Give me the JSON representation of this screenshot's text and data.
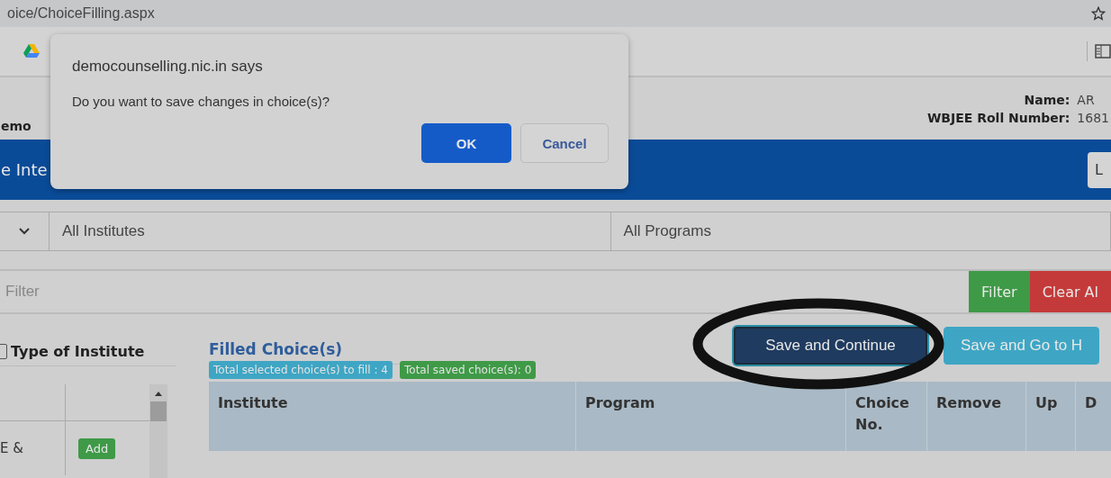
{
  "browser": {
    "url": "oice/ChoiceFilling.aspx"
  },
  "header": {
    "site_title": "emo",
    "name_label": "Name:",
    "name_value": "AR",
    "roll_label": "WBJEE Roll Number:",
    "roll_value": "1681"
  },
  "nav": {
    "item": "e Inte",
    "button": "L"
  },
  "filters": {
    "institutes": "All Institutes",
    "programs": "All Programs",
    "search_placeholder": "Filter",
    "filter_button": "Filter",
    "clear_button": "Clear Al"
  },
  "left_panel": {
    "title": "Type of Institute",
    "checked": false,
    "rows": [
      {
        "name": "E &",
        "action": "Add"
      }
    ]
  },
  "filled": {
    "title": "Filled Choice(s)",
    "badges": [
      {
        "text": "Total selected choice(s) to fill : 4",
        "color": "#3ea6c4"
      },
      {
        "text": "Total saved choice(s): 0",
        "color": "#3f9a47"
      }
    ],
    "buttons": [
      {
        "label": "Save and Continue",
        "kind": "primary"
      },
      {
        "label": "Save and Go to H",
        "kind": "info"
      }
    ],
    "columns": [
      "Institute",
      "Program",
      "Choice No.",
      "Remove",
      "Up",
      "D"
    ]
  },
  "dialog": {
    "title": "democounselling.nic.in says",
    "message": "Do you want to save changes in choice(s)?",
    "buttons": [
      {
        "label": "OK",
        "kind": "primary"
      },
      {
        "label": "Cancel",
        "kind": "secondary"
      }
    ]
  }
}
